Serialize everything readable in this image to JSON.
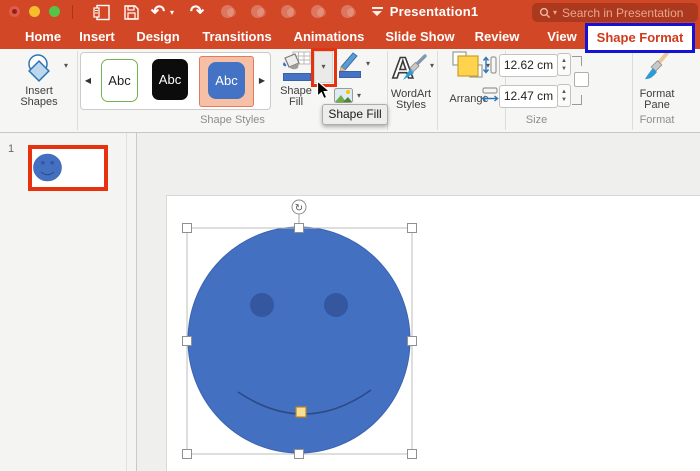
{
  "colors": {
    "app_red": "#D24726",
    "accent_blue": "#4472C4",
    "annotation_red": "#E6320F",
    "annotation_blue": "#1512D8",
    "selection_peach": "#F6C0A6"
  },
  "titlebar": {
    "title": "Presentation1",
    "search_placeholder": "Search in Presentation"
  },
  "tabs": [
    {
      "label": "Home"
    },
    {
      "label": "Insert"
    },
    {
      "label": "Design"
    },
    {
      "label": "Transitions"
    },
    {
      "label": "Animations"
    },
    {
      "label": "Slide Show"
    },
    {
      "label": "Review"
    },
    {
      "label": "View"
    },
    {
      "label": "Shape Format",
      "active": true
    }
  ],
  "ribbon": {
    "insert_shapes": {
      "line1": "Insert",
      "line2": "Shapes"
    },
    "shape_styles": {
      "group_label": "Shape Styles",
      "items": [
        {
          "label": "Abc",
          "style": "white-green-border"
        },
        {
          "label": "Abc",
          "style": "black"
        },
        {
          "label": "Abc",
          "style": "blue-selected"
        }
      ]
    },
    "shape_fill": {
      "line1": "Shape",
      "line2": "Fill"
    },
    "shape_fill_tooltip": "Shape Fill",
    "wordart": {
      "line1": "WordArt",
      "line2": "Styles"
    },
    "arrange": {
      "label": "Arrange"
    },
    "size": {
      "group_label": "Size",
      "height": "12.62 cm",
      "width": "12.47 cm"
    },
    "format_pane": {
      "line1": "Format",
      "line2": "Pane",
      "group_label": "Format"
    }
  },
  "slides_panel": {
    "slide_number": "1"
  },
  "icons": {
    "undo": "↶",
    "redo": "↷",
    "caret_down": "▾",
    "gallery_prev": "◀",
    "gallery_next": "▶",
    "rotate": "↻"
  }
}
